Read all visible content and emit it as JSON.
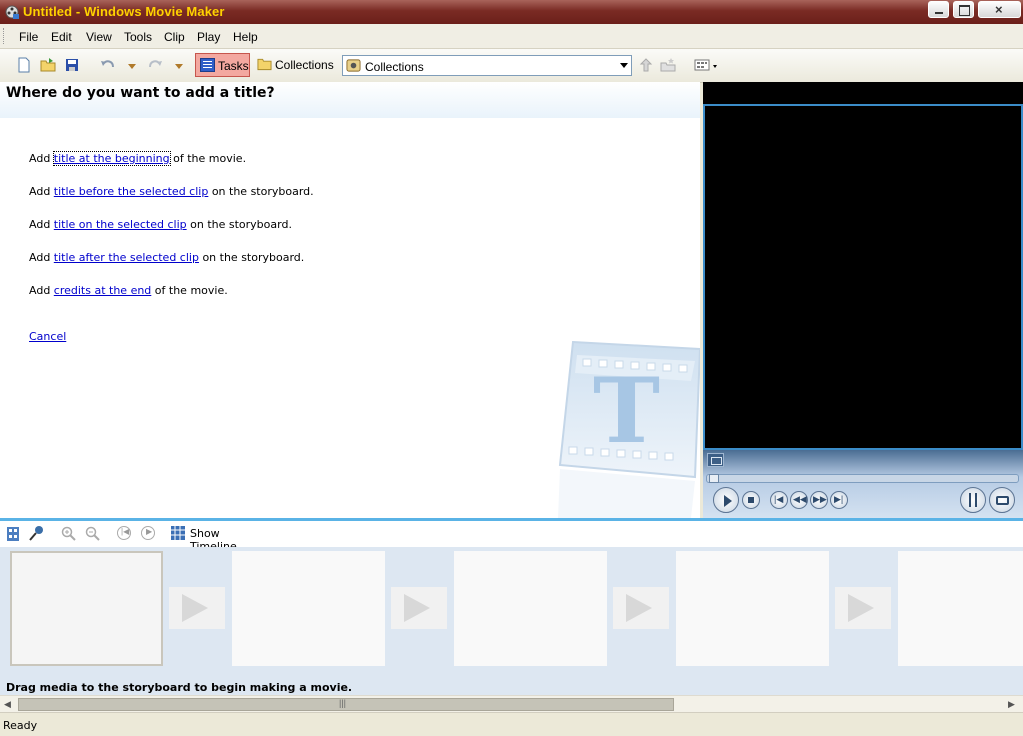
{
  "window": {
    "title": "Untitled - Windows Movie Maker",
    "minimize_icon": "minimize-icon",
    "maximize_icon": "restore-icon",
    "close_icon": "close-icon"
  },
  "menu": [
    "File",
    "Edit",
    "View",
    "Tools",
    "Clip",
    "Play",
    "Help"
  ],
  "toolbar": {
    "tasks_label": "Tasks",
    "collections_label": "Collections",
    "collections_dropdown_value": "Collections"
  },
  "taskpane": {
    "title": "Where do you want to add a title?",
    "options": [
      {
        "prefix": "Add ",
        "link": "title at the beginning",
        "suffix": " of the movie."
      },
      {
        "prefix": "Add ",
        "link": "title before the selected clip",
        "suffix": " on the storyboard."
      },
      {
        "prefix": "Add ",
        "link": "title on the selected clip",
        "suffix": " on the storyboard."
      },
      {
        "prefix": "Add ",
        "link": "title after the selected clip",
        "suffix": " on the storyboard."
      },
      {
        "prefix": "Add ",
        "link": "credits at the end",
        "suffix": " of the movie."
      }
    ],
    "cancel_label": "Cancel",
    "watermark_letter": "T"
  },
  "storyboard": {
    "show_timeline_label": "Show Timeline",
    "empty_message": "Drag media to the storyboard to begin making a movie."
  },
  "scrollbar": {
    "grip": "|||"
  },
  "status": {
    "text": "Ready"
  },
  "colors": {
    "title_text": "#ffd200",
    "titlebar": "#7a2b24",
    "link": "#0000cc",
    "accent_blue": "#5ab3e6"
  }
}
